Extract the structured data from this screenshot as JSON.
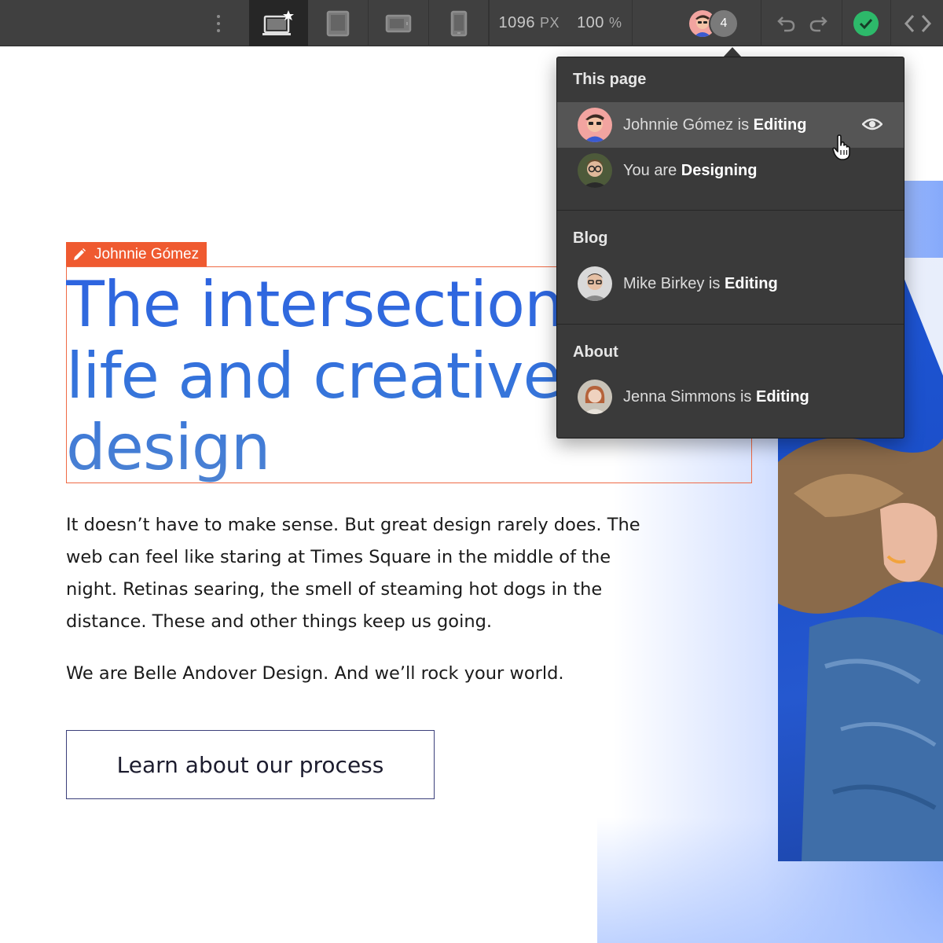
{
  "toolbar": {
    "breakpoints": [
      {
        "name": "desktop",
        "selected": true
      },
      {
        "name": "tablet",
        "selected": false
      },
      {
        "name": "mobile-landscape",
        "selected": false
      },
      {
        "name": "mobile-portrait",
        "selected": false
      }
    ],
    "width_value": "1096",
    "width_unit": "PX",
    "zoom_value": "100",
    "zoom_unit": "%",
    "collaborator_count": "4",
    "icons": [
      "more-vertical-icon",
      "desktop-star-icon",
      "tablet-icon",
      "mobile-landscape-icon",
      "mobile-portrait-icon",
      "undo-icon",
      "redo-icon",
      "check-icon",
      "code-icon"
    ],
    "colors": {
      "bar": "#404040",
      "selected": "#262626",
      "publish": "#2db96a"
    }
  },
  "canvas": {
    "editing_tag": "Johnnie Gómez",
    "hero_title_lines": [
      "The intersection of",
      "life and creative",
      "design"
    ],
    "body_paragraph_1_lines": [
      "It doesn’t have to make sense. But great design rarely does. The",
      "web can feel like staring at Times Square in the middle of the",
      "night. Retinas searing, the smell of steaming hot dogs in the",
      "distance. These and other things keep us going."
    ],
    "body_paragraph_2": "We are Belle Andover Design. And we’ll rock your world.",
    "cta_label": "Learn about our process",
    "colors": {
      "title": "#2b66dc",
      "selection": "#ef6a45",
      "tag": "#ef5a30",
      "photo": "#1e56d6"
    }
  },
  "presence_dropdown": {
    "sections": [
      {
        "heading": "This page",
        "users": [
          {
            "name": "Johnnie Gómez",
            "connector": "is",
            "activity": "Editing",
            "hovered": true
          },
          {
            "name": "You",
            "connector": "are",
            "activity": "Designing",
            "hovered": false
          }
        ]
      },
      {
        "heading": "Blog",
        "users": [
          {
            "name": "Mike Birkey",
            "connector": "is",
            "activity": "Editing",
            "hovered": false
          }
        ]
      },
      {
        "heading": "About",
        "users": [
          {
            "name": "Jenna Simmons",
            "connector": "is",
            "activity": "Editing",
            "hovered": false
          }
        ]
      }
    ],
    "icons": [
      "eye-icon",
      "pointer-hand-icon"
    ]
  }
}
